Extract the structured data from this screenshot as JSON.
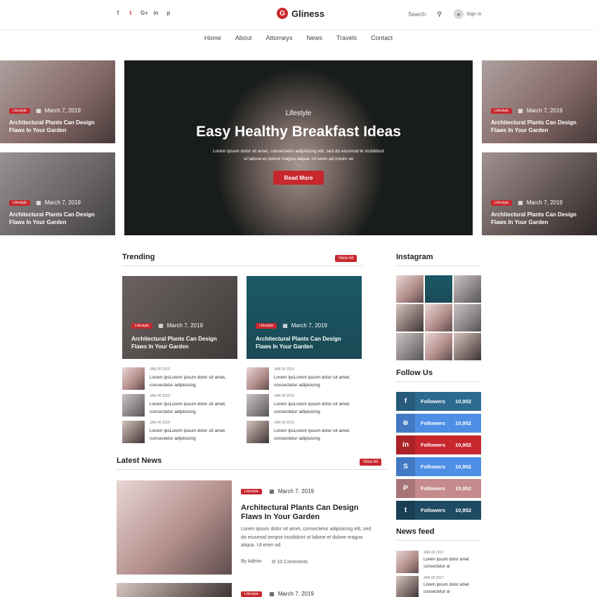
{
  "brand": {
    "name": "Gliness",
    "mark": "G"
  },
  "header": {
    "social_icons": [
      "f",
      "t",
      "G+",
      "in",
      "p"
    ],
    "search_label": "Search",
    "signin_label": "Sign in"
  },
  "nav": [
    "Home",
    "About",
    "Attorneys",
    "News",
    "Travels",
    "Contact"
  ],
  "hero": {
    "category": "Lifestyle",
    "title": "Easy Healthy Breakfast Ideas",
    "description": "Lorem ipsum dolor sit amet, consectetur adipisicing elit, sed do eiusmod te incididunt ut labore et dolore magna aliqua. Ut enim ad minim ve",
    "button": "Read More"
  },
  "side_cards": [
    {
      "tag": "Lifestyle",
      "date": "March 7, 2019",
      "title": "Architectural Plants Can Design Flaws In Your Garden"
    },
    {
      "tag": "Lifestyle",
      "date": "March 7, 2019",
      "title": "Architectural Plants Can Design Flaws In Your Garden"
    },
    {
      "tag": "Lifestyle",
      "date": "March 7, 2019",
      "title": "Architectural Plants Can Design Flaws In Your Garden"
    },
    {
      "tag": "Lifestyle",
      "date": "March 7, 2019",
      "title": "Architectural Plants Can Design Flaws In Your Garden"
    }
  ],
  "trending": {
    "title": "Trending",
    "view_all": "View All",
    "cards": [
      {
        "tag": "Lifestyle",
        "date": "March 7, 2019",
        "title": "Architectural Plants Can Design Flaws In Your Garden"
      },
      {
        "tag": "Lifestyle",
        "date": "March 7, 2019",
        "title": "Architectural Plants Can Design Flaws In Your Garden"
      }
    ],
    "mini_left": [
      {
        "date": "JAN 06 2019",
        "text": "Lorem ipsLorem ipsum dolor sit amet, consectetur adipisicing"
      },
      {
        "date": "JAN 06 2019",
        "text": "Lorem ipsLorem ipsum dolor sit amet, consectetur adipisicing"
      },
      {
        "date": "JAN 06 2019",
        "text": "Lorem ipsLorem ipsum dolor sit amet, consectetur adipisicing"
      }
    ],
    "mini_right": [
      {
        "date": "JAN 06 2019",
        "text": "Lorem ipsLorem ipsum dolor sit amet, consectetur adipisicing"
      },
      {
        "date": "JAN 06 2019",
        "text": "Lorem ipsLorem ipsum dolor sit amet, consectetur adipisicing"
      },
      {
        "date": "JAN 06 2019",
        "text": "Lorem ipsLorem ipsum dolor sit amet, consectetur adipisicing"
      }
    ]
  },
  "latest": {
    "title": "Latest News",
    "view_all": "View All",
    "items": [
      {
        "tag": "Lifestyle",
        "date": "March 7, 2019",
        "title": "Architectural Plants Can Design Flaws In Your Garden",
        "desc": "Lorem ipsum dolor sit amet, consectetur adipisicing elit, sed do eiusmod tempor incididunt ut labore et dolore magna aliqua. Ut enim ad",
        "author": "By Admin",
        "comments": "10 Comments"
      },
      {
        "tag": "Lifestyle",
        "date": "March 7, 2019"
      }
    ]
  },
  "instagram": {
    "title": "Instagram"
  },
  "follow": {
    "title": "Follow Us",
    "rows": [
      {
        "icon": "f",
        "label": "Followers",
        "count": "10,952",
        "color": "#2d6a8f"
      },
      {
        "icon": "⊕",
        "label": "Followers",
        "count": "10,952",
        "color": "#4e8fe6"
      },
      {
        "icon": "in",
        "label": "Followers",
        "count": "10,952",
        "color": "#c8272d"
      },
      {
        "icon": "S",
        "label": "Followers",
        "count": "10,952",
        "color": "#4e8fe6"
      },
      {
        "icon": "P",
        "label": "Followers",
        "count": "10,952",
        "color": "#c58a8d"
      },
      {
        "icon": "t",
        "label": "Followers",
        "count": "10,952",
        "color": "#1e4b63"
      }
    ]
  },
  "feed": {
    "title": "News feed",
    "items": [
      {
        "date": "JAN 06 2017",
        "text": "Lorem ipsum dolor amet consectetur ai"
      },
      {
        "date": "JAN 06 2017",
        "text": "Lorem ipsum dolor amet consectetur ai"
      }
    ]
  },
  "colors": {
    "accent": "#c8272d",
    "text": "#222222"
  }
}
